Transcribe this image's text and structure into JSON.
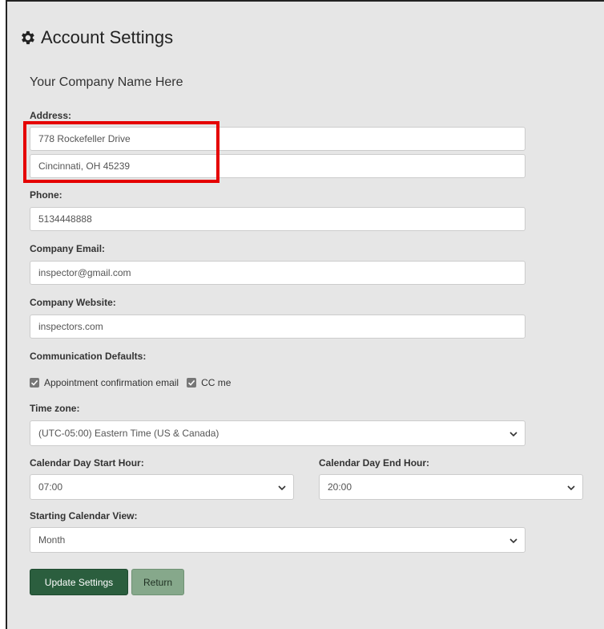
{
  "page": {
    "title": "Account Settings",
    "company_name": "Your Company Name Here"
  },
  "address": {
    "label": "Address:",
    "line1": "778 Rockefeller Drive",
    "line2": "Cincinnati, OH 45239"
  },
  "phone": {
    "label": "Phone:",
    "value": "5134448888"
  },
  "email": {
    "label": "Company Email:",
    "value": "inspector@gmail.com"
  },
  "website": {
    "label": "Company Website:",
    "value": "inspectors.com"
  },
  "communication": {
    "label": "Communication Defaults:",
    "confirm_label": "Appointment confirmation email",
    "confirm_checked": true,
    "cc_label": "CC me",
    "cc_checked": true
  },
  "timezone": {
    "label": "Time zone:",
    "value": "(UTC-05:00) Eastern Time (US & Canada)"
  },
  "start_hour": {
    "label": "Calendar Day Start Hour:",
    "value": "07:00"
  },
  "end_hour": {
    "label": "Calendar Day End Hour:",
    "value": "20:00"
  },
  "calendar_view": {
    "label": "Starting Calendar View:",
    "value": "Month"
  },
  "buttons": {
    "update": "Update Settings",
    "return": "Return"
  },
  "colors": {
    "highlight": "#e50000",
    "primary_button": "#2b5e3e",
    "secondary_button": "#86a88b",
    "panel": "#e6e6e6"
  },
  "icons": {
    "title": "gear-icon",
    "checkbox": "checkmark-icon",
    "select": "chevron-down-icon"
  }
}
